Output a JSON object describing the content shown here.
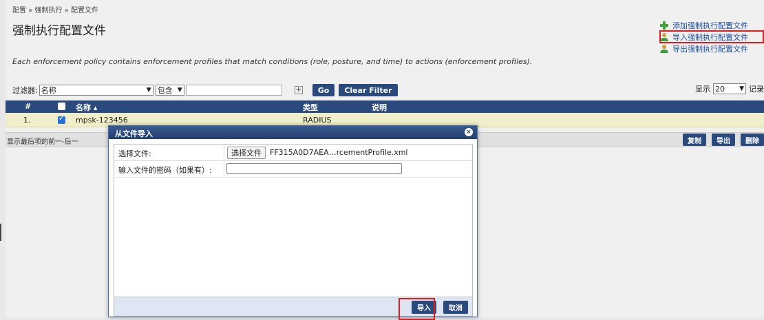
{
  "breadcrumb": "配置 » 强制执行 » 配置文件",
  "page_title": "强制执行配置文件",
  "actions": [
    {
      "label": "添加强制执行配置文件",
      "icon": "add-icon"
    },
    {
      "label": "导入强制执行配置文件",
      "icon": "import-icon"
    },
    {
      "label": "导出强制执行配置文件",
      "icon": "export-icon"
    }
  ],
  "description": "Each enforcement policy contains enforcement profiles that match conditions (role, posture, and time) to actions (enforcement profiles).",
  "filter": {
    "label": "过滤器:",
    "field": "名称",
    "operator": "包含",
    "value": "",
    "plus": "+",
    "go_label": "Go",
    "clear_label": "Clear Filter"
  },
  "page_size": {
    "label": "显示",
    "value": "20",
    "suffix": "记录"
  },
  "table": {
    "headers": {
      "num": "#",
      "name": "名称 ▴",
      "type": "类型",
      "desc": "说明"
    },
    "rows": [
      {
        "num": "1.",
        "checked": true,
        "name": "mpsk-123456",
        "type": "RADIUS",
        "desc": ""
      }
    ]
  },
  "pager": {
    "text": "显示最后项的前一-后一",
    "buttons": {
      "copy": "复制",
      "export": "导出",
      "delete": "删除"
    }
  },
  "dialog": {
    "title": "从文件导入",
    "close": "×",
    "file_label": "选择文件:",
    "file_button": "选择文件",
    "file_name": "FF315A0D7AEA…rcementProfile.xml",
    "password_label": "输入文件的密码（如果有）:",
    "password_value": "",
    "import_label": "导入",
    "cancel_label": "取消"
  },
  "colors": {
    "accent": "#2a4a7d",
    "highlight": "#e01c1c",
    "row": "#f1efc9"
  }
}
